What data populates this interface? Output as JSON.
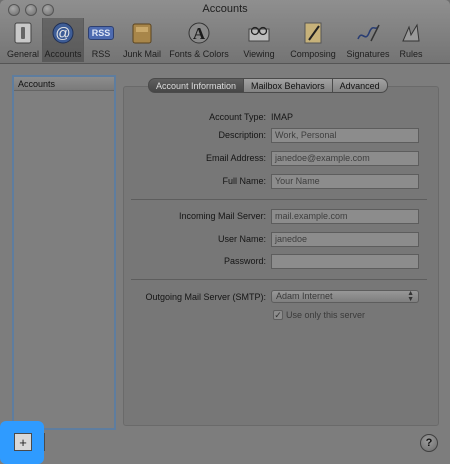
{
  "window": {
    "title": "Accounts"
  },
  "toolbar": {
    "items": [
      {
        "label": "General",
        "icon": "switch-icon"
      },
      {
        "label": "Accounts",
        "icon": "at-sign-icon"
      },
      {
        "label": "RSS",
        "icon": "rss-icon"
      },
      {
        "label": "Junk Mail",
        "icon": "junk-mail-icon"
      },
      {
        "label": "Fonts & Colors",
        "icon": "fonts-colors-icon"
      },
      {
        "label": "Viewing",
        "icon": "glasses-icon"
      },
      {
        "label": "Composing",
        "icon": "pencil-icon"
      },
      {
        "label": "Signatures",
        "icon": "signature-icon"
      },
      {
        "label": "Rules",
        "icon": "rules-icon"
      }
    ],
    "selected": "Accounts",
    "rss_badge": "RSS"
  },
  "accounts_list": {
    "header": "Accounts"
  },
  "buttons": {
    "add": "+",
    "help": "?"
  },
  "tabs": [
    {
      "label": "Account Information",
      "active": true
    },
    {
      "label": "Mailbox Behaviors",
      "active": false
    },
    {
      "label": "Advanced",
      "active": false
    }
  ],
  "form": {
    "account_type": {
      "label": "Account Type:",
      "value": "IMAP"
    },
    "description": {
      "label": "Description:",
      "placeholder": "Work, Personal"
    },
    "email": {
      "label": "Email Address:",
      "placeholder": "janedoe@example.com"
    },
    "full_name": {
      "label": "Full Name:",
      "placeholder": "Your Name"
    },
    "incoming_server": {
      "label": "Incoming Mail Server:",
      "placeholder": "mail.example.com"
    },
    "user_name": {
      "label": "User Name:",
      "placeholder": "janedoe"
    },
    "password": {
      "label": "Password:",
      "value": ""
    },
    "smtp": {
      "label": "Outgoing Mail Server (SMTP):",
      "value": "Adam Internet"
    },
    "only_this_server": {
      "label": "Use only this server",
      "checked": true,
      "mark": "✓"
    }
  },
  "colors": {
    "highlight": "#2f9bff",
    "list_border": "#5e7d9f"
  }
}
